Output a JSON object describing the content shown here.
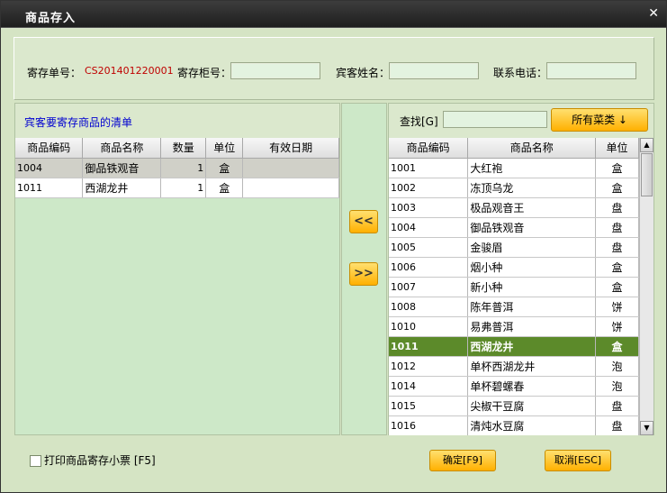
{
  "window": {
    "title": "商品存入",
    "close_glyph": "✕"
  },
  "header": {
    "deposit_no_label": "寄存单号：",
    "deposit_no_value": "CS201401220001",
    "cabinet_label": "寄存柜号：",
    "cabinet_value": "",
    "guest_name_label": "宾客姓名：",
    "guest_name_value": "",
    "phone_label": "联系电话：",
    "phone_value": ""
  },
  "left": {
    "title": "宾客要寄存商品的清单",
    "columns": [
      "商品编码",
      "商品名称",
      "数量",
      "单位",
      "有效日期"
    ],
    "rows": [
      {
        "code": "1004",
        "name": "御品铁观音",
        "qty": "1",
        "unit": "盒",
        "expiry": ""
      },
      {
        "code": "1011",
        "name": "西湖龙井",
        "qty": "1",
        "unit": "盒",
        "expiry": ""
      }
    ]
  },
  "middle": {
    "add_label": "<<",
    "remove_label": ">>"
  },
  "right": {
    "search_label": "查找[G]",
    "search_value": "",
    "category_button": "所有菜类 ↓",
    "columns": [
      "商品编码",
      "商品名称",
      "单位"
    ],
    "rows": [
      {
        "code": "1001",
        "name": "大红袍",
        "unit": "盒"
      },
      {
        "code": "1002",
        "name": "冻顶乌龙",
        "unit": "盒"
      },
      {
        "code": "1003",
        "name": "极品观音王",
        "unit": "盘"
      },
      {
        "code": "1004",
        "name": "御品铁观音",
        "unit": "盘"
      },
      {
        "code": "1005",
        "name": "金骏眉",
        "unit": "盘"
      },
      {
        "code": "1006",
        "name": "烟小种",
        "unit": "盒"
      },
      {
        "code": "1007",
        "name": "新小种",
        "unit": "盒"
      },
      {
        "code": "1008",
        "name": "陈年普洱",
        "unit": "饼"
      },
      {
        "code": "1010",
        "name": "易弗普洱",
        "unit": "饼"
      },
      {
        "code": "1011",
        "name": "西湖龙井",
        "unit": "盒"
      },
      {
        "code": "1012",
        "name": "单杯西湖龙井",
        "unit": "泡"
      },
      {
        "code": "1014",
        "name": "单杯碧螺春",
        "unit": "泡"
      },
      {
        "code": "1015",
        "name": "尖椒干豆腐",
        "unit": "盘"
      },
      {
        "code": "1016",
        "name": "清炖水豆腐",
        "unit": "盘"
      }
    ],
    "highlight_index": 9
  },
  "footer": {
    "print_label": "打印商品寄存小票 [F5]",
    "ok_label": "确定[F9]",
    "cancel_label": "取消[ESC]"
  }
}
